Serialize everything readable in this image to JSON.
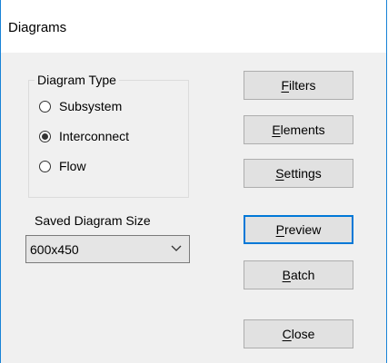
{
  "window": {
    "title": "Diagrams"
  },
  "diagram_type": {
    "label": "Diagram Type",
    "options": [
      {
        "label": "Subsystem",
        "checked": false
      },
      {
        "label": "Interconnect",
        "checked": true
      },
      {
        "label": "Flow",
        "checked": false
      }
    ]
  },
  "saved_size": {
    "label": "Saved Diagram Size",
    "value": "600x450"
  },
  "buttons": {
    "filters": {
      "mnemonic": "F",
      "rest": "ilters"
    },
    "elements": {
      "mnemonic": "E",
      "rest": "lements"
    },
    "settings": {
      "mnemonic": "S",
      "rest": "ettings"
    },
    "preview": {
      "mnemonic": "P",
      "rest": "review"
    },
    "batch": {
      "mnemonic": "B",
      "rest": "atch"
    },
    "close": {
      "mnemonic": "C",
      "rest": "lose"
    }
  },
  "colors": {
    "accent": "#0078d7",
    "border": "#1883d7",
    "background": "#f0f0f0"
  }
}
